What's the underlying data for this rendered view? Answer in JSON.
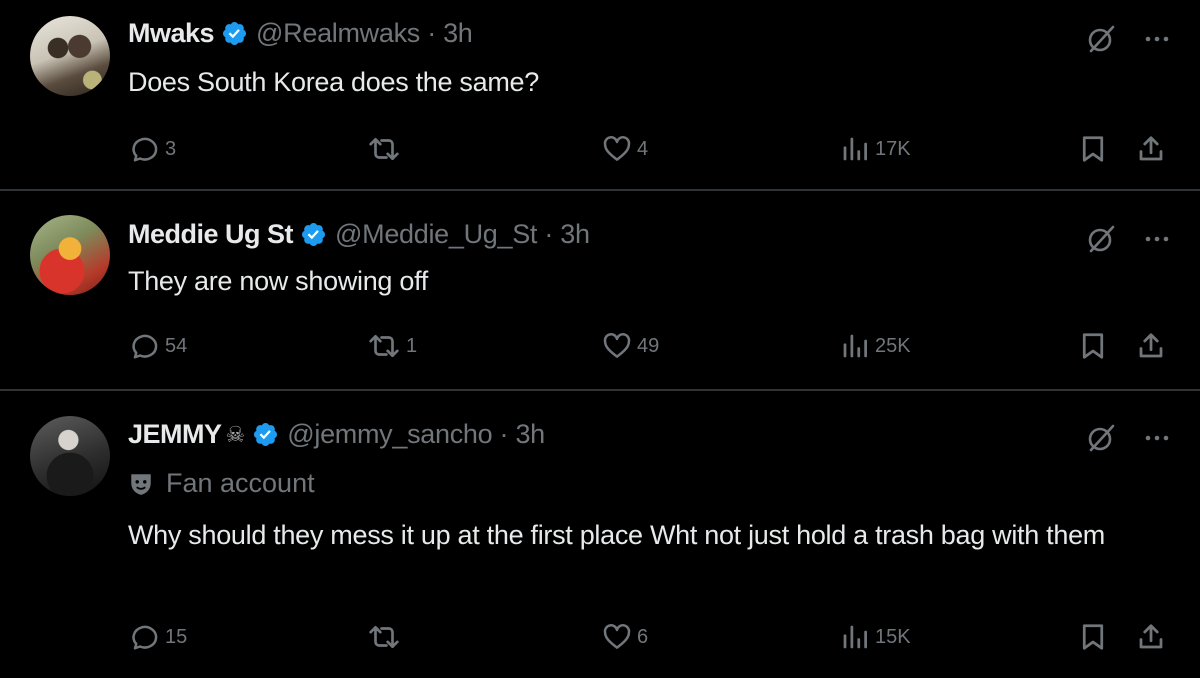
{
  "tweets": [
    {
      "name": "Mwaks",
      "handle": "@Realmwaks · 3h",
      "label": "",
      "text": "Does South Korea does the same?",
      "replies": "3",
      "retweets": "",
      "likes": "4",
      "views": "17K"
    },
    {
      "name": "Meddie Ug St",
      "handle": "@Meddie_Ug_St · 3h",
      "label": "",
      "text": "They are now showing off",
      "replies": "54",
      "retweets": "1",
      "likes": "49",
      "views": "25K"
    },
    {
      "name": "JEMMY",
      "name_emoji": "☠",
      "handle": "@jemmy_sancho · 3h",
      "label": "Fan account",
      "text": "Why should they mess it up at the first place Wht not just hold a trash bag with them",
      "replies": "15",
      "retweets": "",
      "likes": "6",
      "views": "15K"
    }
  ],
  "colors": {
    "background": "#000000",
    "text": "#e7e9ea",
    "secondary": "#71767b",
    "verified": "#1d9bf0",
    "divider": "#2f3336"
  },
  "icons": [
    "verified-icon",
    "grok-icon",
    "more-icon",
    "reply-icon",
    "retweet-icon",
    "like-icon",
    "views-icon",
    "bookmark-icon",
    "share-icon",
    "fan-account-icon"
  ]
}
